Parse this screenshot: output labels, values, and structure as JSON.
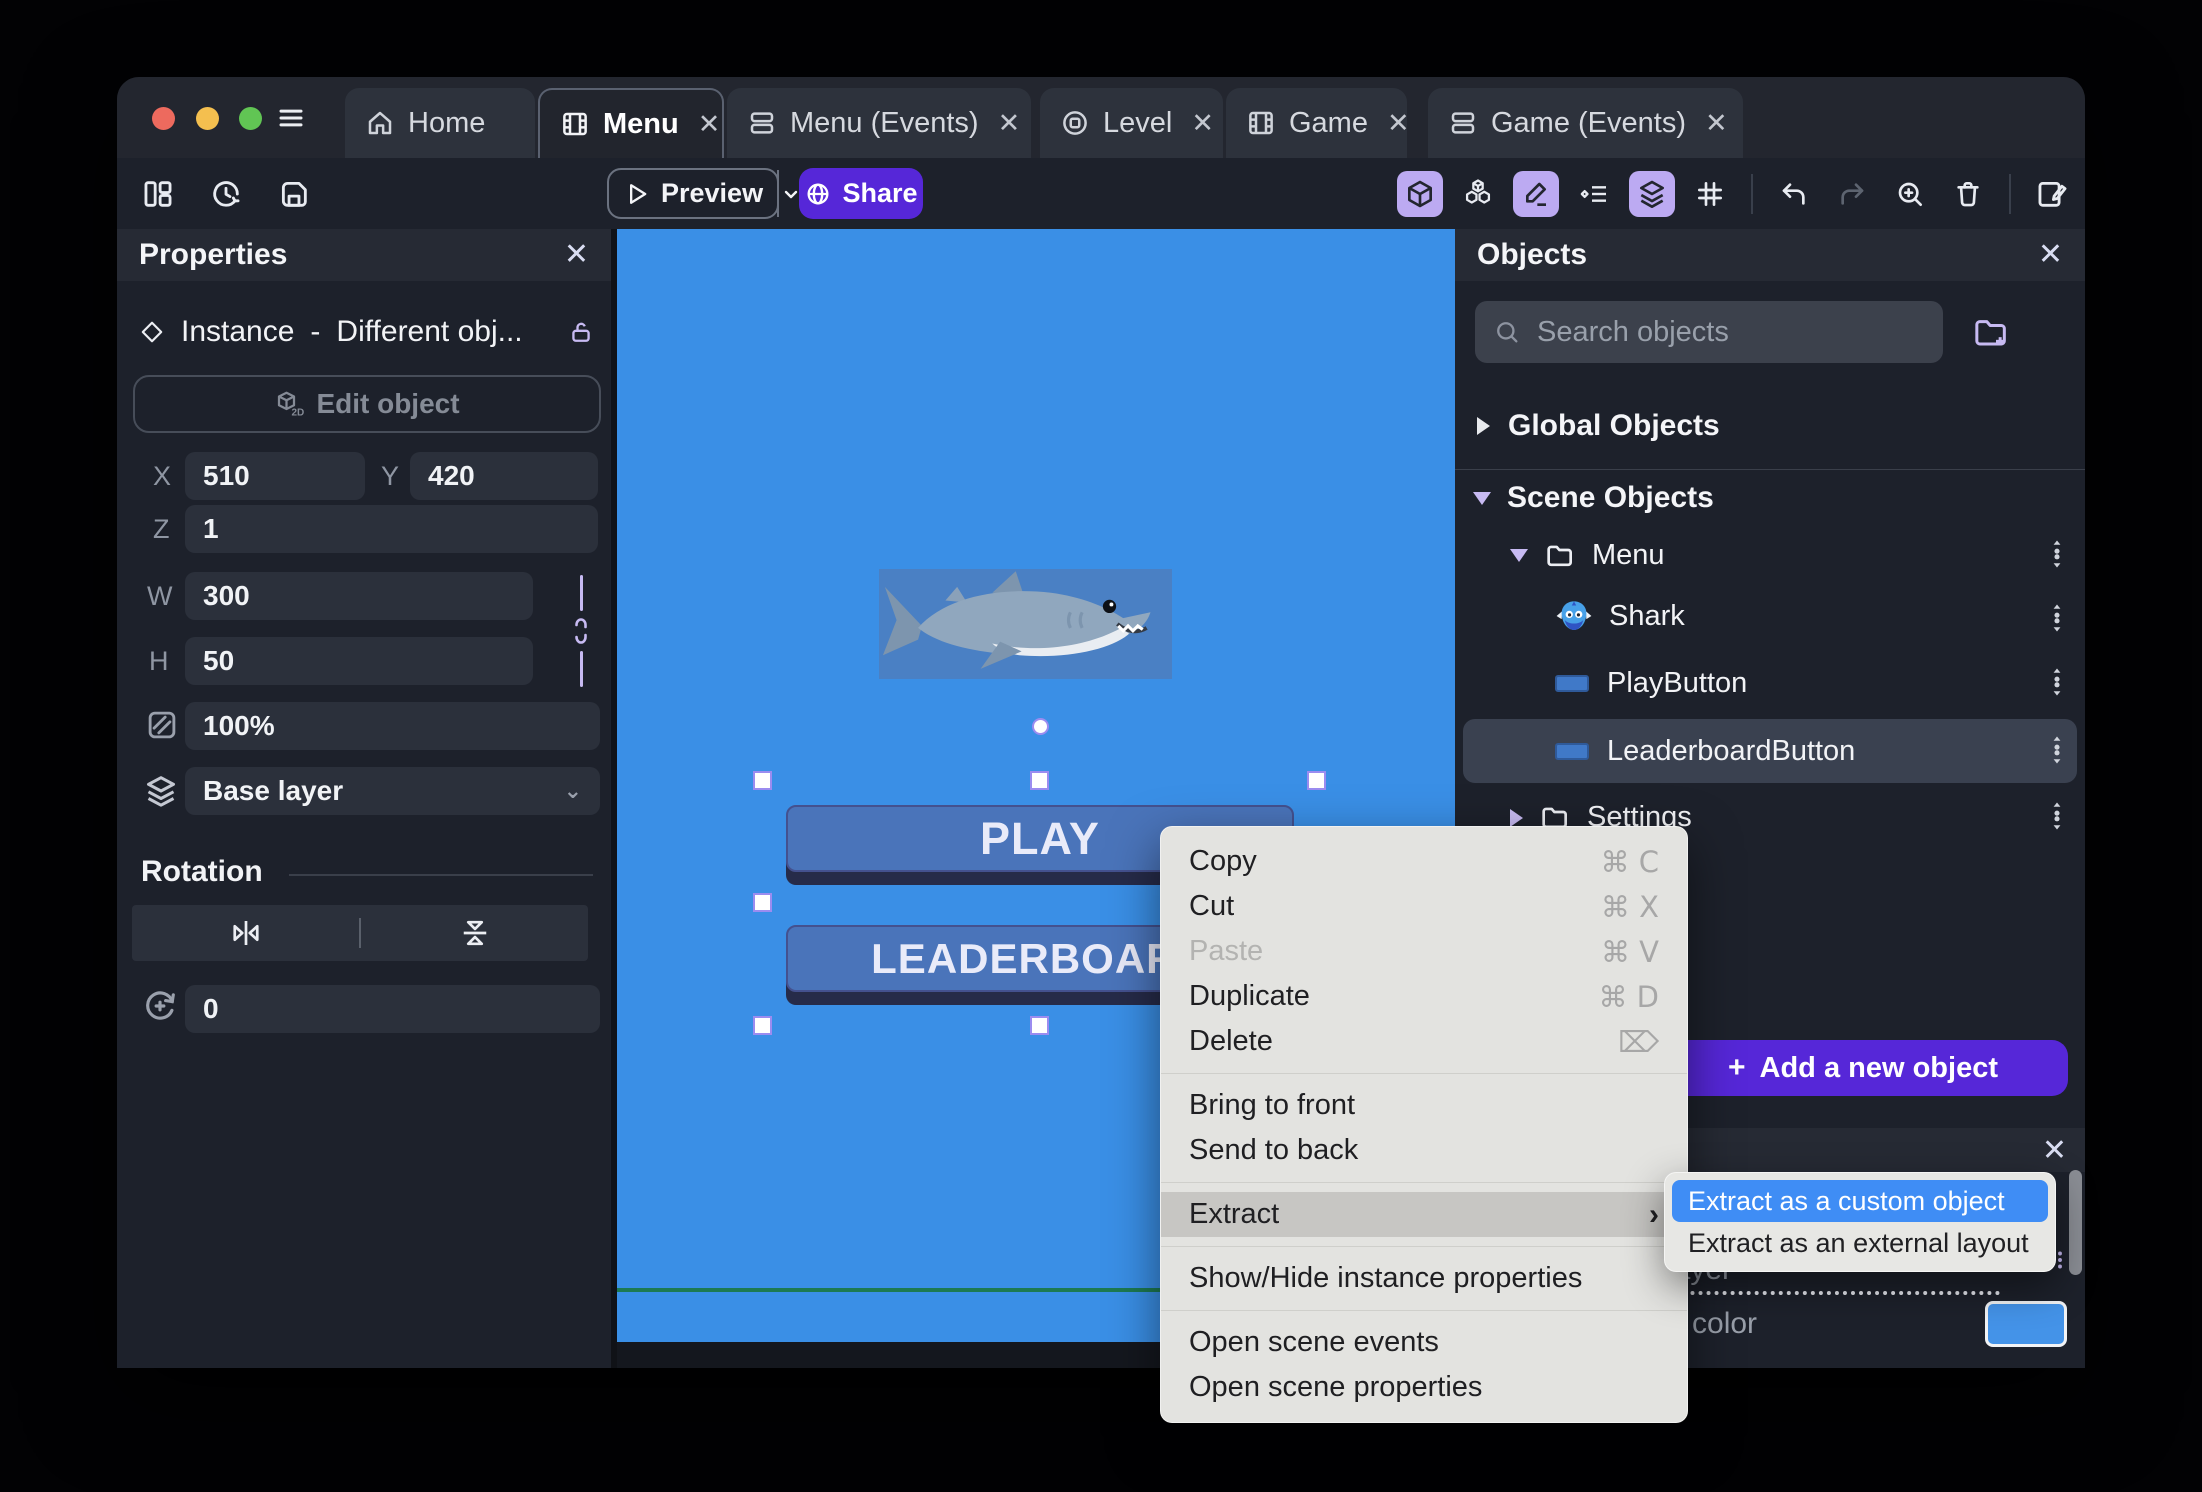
{
  "window": {
    "tabs": [
      {
        "label": "Home",
        "icon": "home-icon",
        "active": false,
        "closable": false
      },
      {
        "label": "Menu",
        "icon": "scene-icon",
        "active": true,
        "closable": true
      },
      {
        "label": "Menu (Events)",
        "icon": "events-icon",
        "active": false,
        "closable": true
      },
      {
        "label": "Level",
        "icon": "level-icon",
        "active": false,
        "closable": true
      },
      {
        "label": "Game",
        "icon": "scene-icon",
        "active": false,
        "closable": true
      },
      {
        "label": "Game (Events)",
        "icon": "events-icon",
        "active": false,
        "closable": true
      }
    ],
    "close_glyph": "✕"
  },
  "toolbar": {
    "preview_label": "Preview",
    "share_label": "Share"
  },
  "properties_panel": {
    "title": "Properties",
    "instance_label": "Instance",
    "separator": "-",
    "instance_value": "Different obj...",
    "edit_object_label": "Edit object",
    "x_label": "X",
    "x_value": "510",
    "y_label": "Y",
    "y_value": "420",
    "z_label": "Z",
    "z_value": "1",
    "w_label": "W",
    "w_value": "300",
    "h_label": "H",
    "h_value": "50",
    "opacity_value": "100%",
    "layer_value": "Base layer",
    "rotation_title": "Rotation",
    "rotation_value": "0"
  },
  "canvas": {
    "background_color": "#3a8fe6",
    "play_label": "PLAY",
    "leaderboard_label": "LEADERBOARD"
  },
  "objects_panel": {
    "title": "Objects",
    "search_placeholder": "Search objects",
    "global_objects_label": "Global Objects",
    "scene_objects_label": "Scene Objects",
    "tree": [
      {
        "label": "Menu",
        "type": "folder",
        "expanded": true
      },
      {
        "label": "Shark",
        "type": "sprite"
      },
      {
        "label": "PlayButton",
        "type": "button"
      },
      {
        "label": "LeaderboardButton",
        "type": "button",
        "selected": true
      },
      {
        "label": "Settings",
        "type": "folder",
        "expanded": false
      }
    ],
    "add_object_label": "Add a new object"
  },
  "layers_panel": {
    "layer_fragment": "layer",
    "color_fragment": "d color",
    "swatch_color": "#4493e8"
  },
  "context_menu": {
    "items": [
      {
        "label": "Copy",
        "shortcut": "⌘ C"
      },
      {
        "label": "Cut",
        "shortcut": "⌘ X"
      },
      {
        "label": "Paste",
        "shortcut": "⌘ V",
        "disabled": true
      },
      {
        "label": "Duplicate",
        "shortcut": "⌘ D"
      },
      {
        "label": "Delete",
        "shortcut": "⌦"
      },
      {
        "label": "Bring to front"
      },
      {
        "label": "Send to back"
      },
      {
        "label": "Extract",
        "has_submenu": true,
        "highlighted": true,
        "arrow": "›"
      },
      {
        "label": "Show/Hide instance properties"
      },
      {
        "label": "Open scene events"
      },
      {
        "label": "Open scene properties"
      }
    ],
    "submenu": [
      {
        "label": "Extract as a custom object",
        "highlighted": true
      },
      {
        "label": "Extract as an external layout"
      }
    ]
  },
  "colors": {
    "accent_purple": "#5627d8",
    "toggle_highlight": "#bcaaf2",
    "canvas_blue": "#3a8fe6",
    "selection_handle_border": "#9b8cf0",
    "submenu_highlight_blue": "#3f8df5"
  }
}
